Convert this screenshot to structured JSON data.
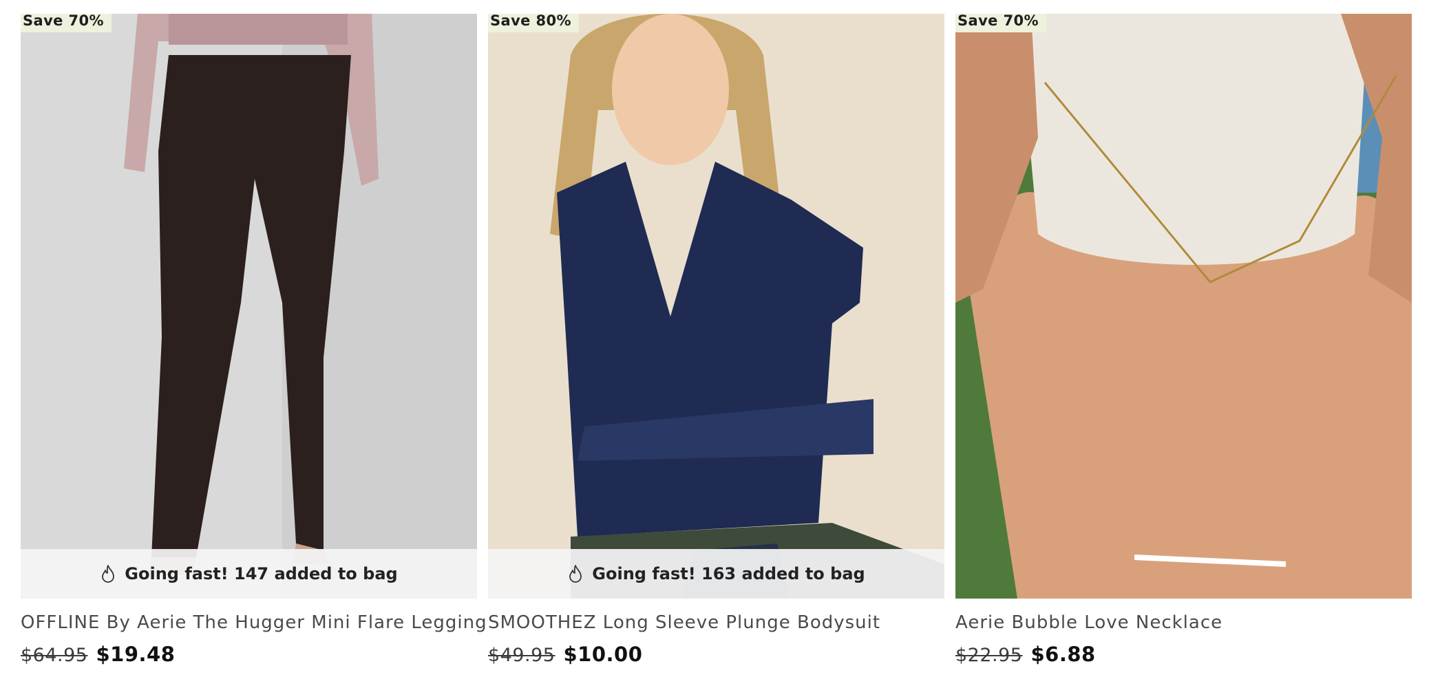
{
  "products": [
    {
      "badge": "Save 70%",
      "image_alt": "photo",
      "going_fast": "Going fast! 147 added to bag",
      "title": "OFFLINE By Aerie The Hugger Mini Flare Legging",
      "old_price": "$64.95",
      "new_price": "$19.48"
    },
    {
      "badge": "Save 80%",
      "image_alt": "photo",
      "going_fast": "Going fast! 163 added to bag",
      "title": "SMOOTHEZ Long Sleeve Plunge Bodysuit",
      "old_price": "$49.95",
      "new_price": "$10.00"
    },
    {
      "badge": "Save 70%",
      "image_alt": "photo",
      "title": "Aerie Bubble Love Necklace",
      "old_price": "$22.95",
      "new_price": "$6.88"
    }
  ],
  "icons": {
    "going_fast": "flame-icon"
  },
  "colors": {
    "badge_bg": "#eef1dc",
    "going_fast_bg": "#f4f4f4"
  }
}
